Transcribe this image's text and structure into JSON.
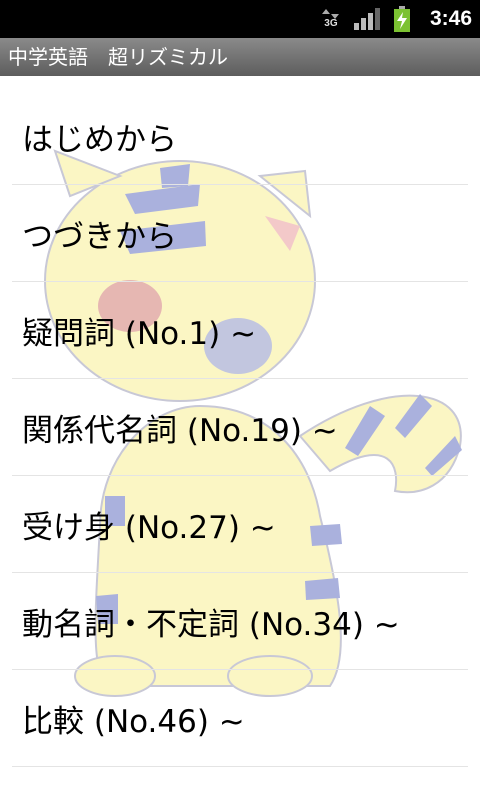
{
  "status_bar": {
    "network": "3G",
    "clock": "3:46",
    "icons": [
      "data-transfer-icon",
      "signal-strength-icon",
      "battery-charging-icon"
    ]
  },
  "app": {
    "title": "中学英語　超リズミカル"
  },
  "menu": [
    {
      "label": "はじめから"
    },
    {
      "label": "つづきから"
    },
    {
      "label": "疑問詞 (No.1) ~"
    },
    {
      "label": "関係代名詞 (No.19) ~"
    },
    {
      "label": "受け身 (No.27) ~"
    },
    {
      "label": "動名詞・不定詞 (No.34) ~"
    },
    {
      "label": "比較 (No.46) ~"
    }
  ],
  "colors": {
    "mascot_yellow": "#fbf6c4",
    "mascot_stripe": "#aab1dd"
  }
}
